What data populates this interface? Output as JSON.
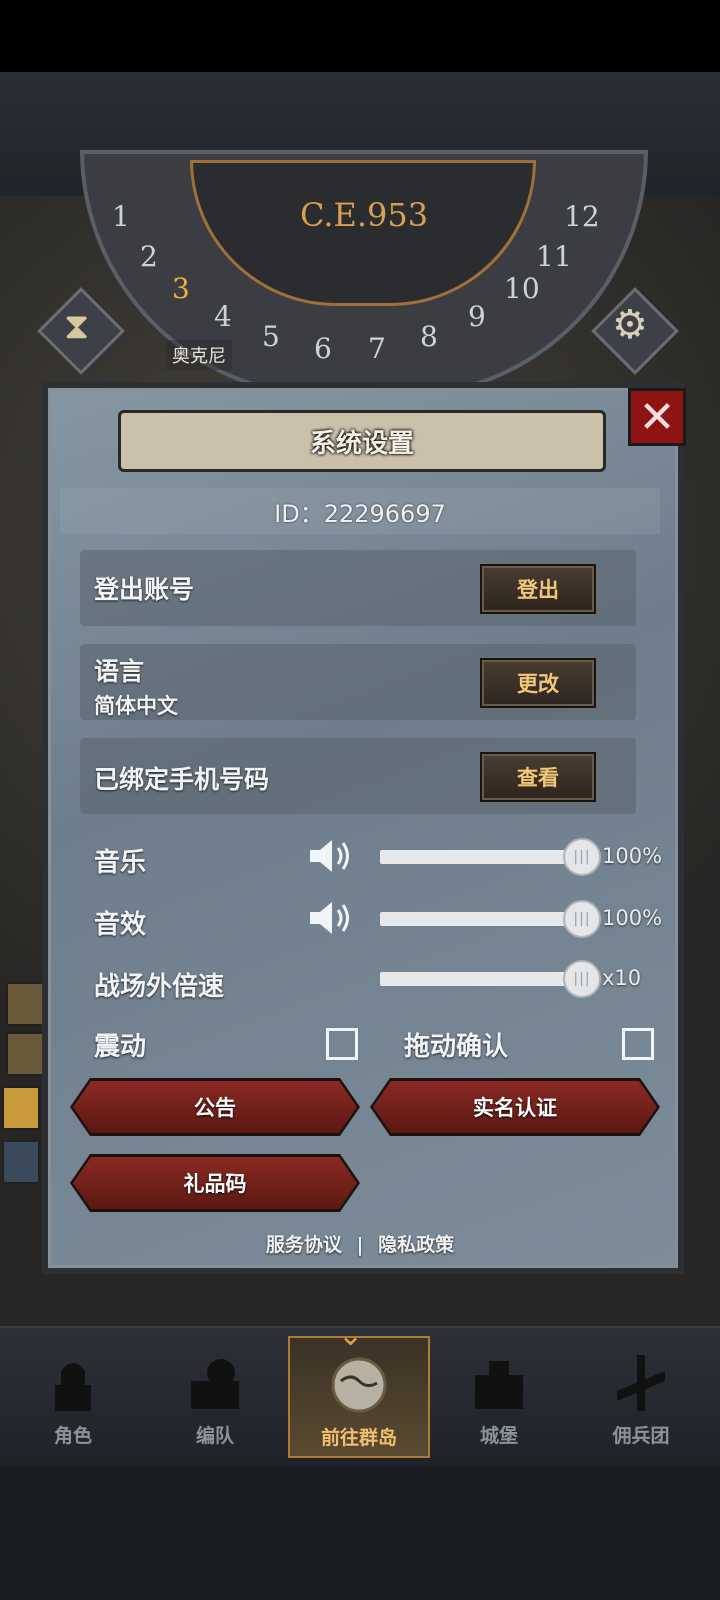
{
  "header": {
    "era": "C.E.953",
    "dial_numbers": [
      "1",
      "2",
      "3",
      "4",
      "5",
      "6",
      "7",
      "8",
      "9",
      "10",
      "11",
      "12"
    ],
    "map_place": "奥克尼"
  },
  "dialog": {
    "title": "系统设置",
    "id_text": "ID：22296697",
    "rows": [
      {
        "label": "登出账号",
        "sub": "",
        "button": "登出"
      },
      {
        "label": "语言",
        "sub": "简体中文",
        "button": "更改"
      },
      {
        "label": "已绑定手机号码",
        "sub": "",
        "button": "查看"
      }
    ],
    "sliders": [
      {
        "label": "音乐",
        "value_text": "100%",
        "value": 100,
        "has_speaker": true
      },
      {
        "label": "音效",
        "value_text": "100%",
        "value": 100,
        "has_speaker": true
      },
      {
        "label": "战场外倍速",
        "value_text": "x10",
        "value": 100,
        "has_speaker": false
      }
    ],
    "vibration_label": "震动",
    "drag_confirm_label": "拖动确认",
    "buttons": {
      "notice": "公告",
      "realname": "实名认证",
      "gift": "礼品码"
    },
    "links": {
      "service": "服务协议",
      "sep": "|",
      "privacy": "隐私政策"
    }
  },
  "bottom_nav": {
    "tabs": [
      {
        "label": "角色",
        "icon": "knight-icon",
        "active": false
      },
      {
        "label": "编队",
        "icon": "squad-icon",
        "active": false
      },
      {
        "label": "前往群岛",
        "icon": "globe-icon",
        "active": true
      },
      {
        "label": "城堡",
        "icon": "castle-icon",
        "active": false
      },
      {
        "label": "佣兵团",
        "icon": "mercenary-icon",
        "active": false
      }
    ]
  },
  "colors": {
    "accent_gold": "#f0c070",
    "close_red": "#8e1414",
    "button_red": "#8a2a24"
  }
}
